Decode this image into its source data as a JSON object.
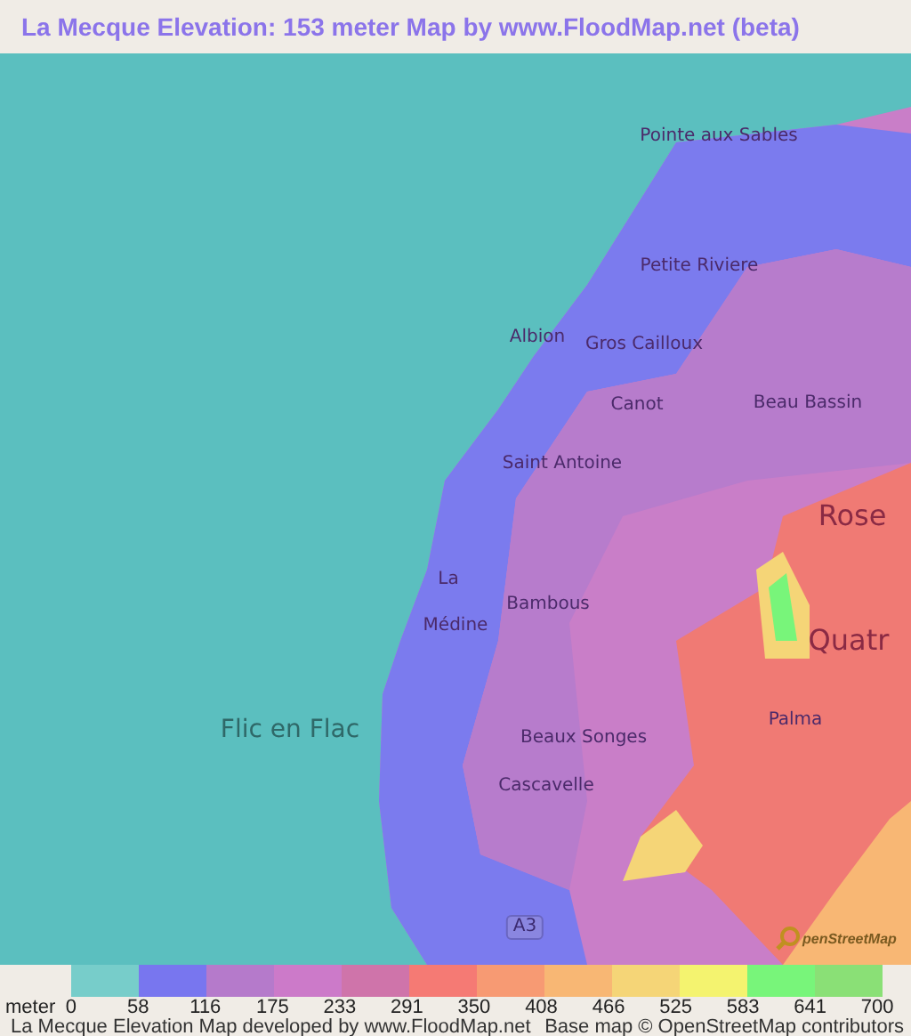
{
  "title": "La Mecque Elevation: 153 meter Map by www.FloodMap.net (beta)",
  "map": {
    "labels": [
      {
        "text": "Pointe aux Sables",
        "kind": "village"
      },
      {
        "text": "Petite Riviere",
        "kind": "village"
      },
      {
        "text": "Albion",
        "kind": "village"
      },
      {
        "text": "Gros Cailloux",
        "kind": "village"
      },
      {
        "text": "Canot",
        "kind": "village"
      },
      {
        "text": "Beau Bassin",
        "kind": "village"
      },
      {
        "text": "Saint Antoine",
        "kind": "village"
      },
      {
        "text": "Rose",
        "kind": "town"
      },
      {
        "text": "La",
        "kind": "village"
      },
      {
        "text": "Bambous",
        "kind": "village"
      },
      {
        "text": "Médine",
        "kind": "village"
      },
      {
        "text": "Quatr",
        "kind": "town"
      },
      {
        "text": "Flic en Flac",
        "kind": "coast"
      },
      {
        "text": "Palma",
        "kind": "village"
      },
      {
        "text": "Beaux Songes",
        "kind": "village"
      },
      {
        "text": "Cascavelle",
        "kind": "village"
      },
      {
        "text": "A3",
        "kind": "road"
      }
    ],
    "attribution_logo": "penStreetMap"
  },
  "legend": {
    "unit": "meter",
    "colors": [
      {
        "color": "#77cdca"
      },
      {
        "color": "#7876ef"
      },
      {
        "color": "#b57acb"
      },
      {
        "color": "#cc7ac9"
      },
      {
        "color": "#cf74aa"
      },
      {
        "color": "#f57a74"
      },
      {
        "color": "#f79a73"
      },
      {
        "color": "#f8b774"
      },
      {
        "color": "#f5d577"
      },
      {
        "color": "#f4f36f"
      },
      {
        "color": "#78f57a"
      },
      {
        "color": "#8ae076"
      }
    ],
    "ticks": [
      "0",
      "58",
      "116",
      "175",
      "233",
      "291",
      "350",
      "408",
      "466",
      "525",
      "583",
      "641",
      "700"
    ]
  },
  "footer": {
    "left": "La Mecque Elevation Map developed by www.FloodMap.net",
    "right": "Base map © OpenStreetMap contributors"
  }
}
